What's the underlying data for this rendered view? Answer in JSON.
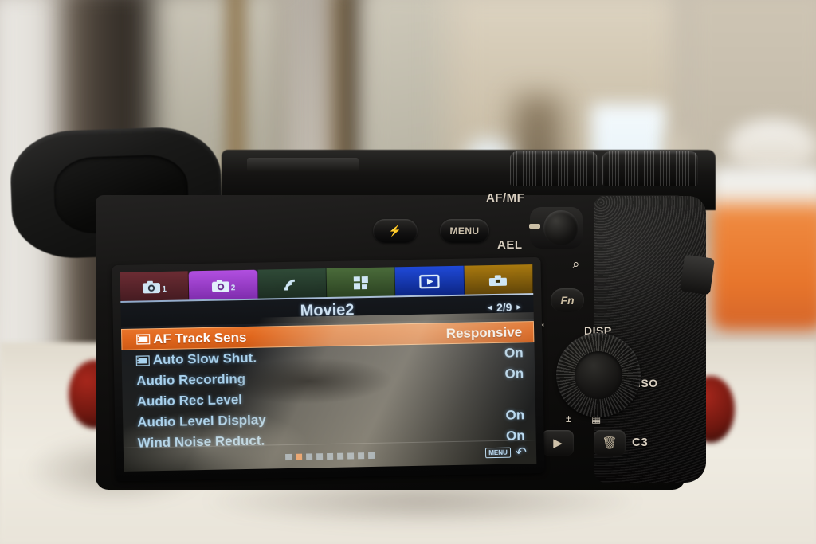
{
  "device": {
    "type": "mirrorless-camera-rear",
    "body_labels": {
      "af_mf": "AF/MF",
      "ael": "AEL",
      "menu": "MENU",
      "fn": "Fn",
      "disp": "DISP",
      "iso": "ISO",
      "c3": "C3"
    },
    "buttons": {
      "flash_icon": "flash-icon",
      "magnifier_icon": "zoom-in-icon",
      "play_icon": "play-icon",
      "trash_icon": "trash-icon",
      "export_icon": "export-icon",
      "timer_icon": "self-timer-icon",
      "drive_icon": "drive-mode-icon",
      "exp_comp_icon": "exposure-compensation-icon",
      "creative_icon": "photo-creativity-icon"
    }
  },
  "screen": {
    "tabs": [
      {
        "name": "camera-settings-1",
        "icon": "camera-icon",
        "num": "1",
        "color": "#6b2c33",
        "active": false
      },
      {
        "name": "camera-settings-2",
        "icon": "camera-icon",
        "num": "2",
        "color": "#a03fd0",
        "active": true
      },
      {
        "name": "network",
        "icon": "wireless-icon",
        "num": "",
        "color": "#2f4a37",
        "active": false
      },
      {
        "name": "application",
        "icon": "apps-icon",
        "num": "",
        "color": "#4a6b3a",
        "active": false
      },
      {
        "name": "playback",
        "icon": "playback-icon",
        "num": "",
        "color": "#1433b4",
        "active": false
      },
      {
        "name": "setup",
        "icon": "toolbox-icon",
        "num": "",
        "color": "#8a6312",
        "active": false
      }
    ],
    "title": "Movie2",
    "pager": {
      "prev": "◂",
      "page": "2/9",
      "next": "▸"
    },
    "rows": [
      {
        "label": "AF Track Sens",
        "value": "Responsive",
        "icon": "movie-icon",
        "selected": true
      },
      {
        "label": "Auto Slow Shut.",
        "value": "On",
        "icon": "movie-icon",
        "selected": false
      },
      {
        "label": "Audio Recording",
        "value": "On",
        "icon": "",
        "selected": false
      },
      {
        "label": "Audio Rec Level",
        "value": "",
        "icon": "",
        "selected": false
      },
      {
        "label": "Audio Level Display",
        "value": "On",
        "icon": "",
        "selected": false
      },
      {
        "label": "Wind Noise Reduct.",
        "value": "On",
        "icon": "",
        "selected": false
      }
    ],
    "footer": {
      "page_dots_total": 9,
      "page_dots_active_index": 1,
      "menu_badge": "MENU",
      "back_arrow": "↶"
    },
    "colors": {
      "highlight": "#e8742a",
      "highlight_border": "#f6ab6d",
      "text": "#a9d2ee",
      "active_tab": "#a03fd0",
      "dot_active": "#ec7a2d"
    }
  }
}
